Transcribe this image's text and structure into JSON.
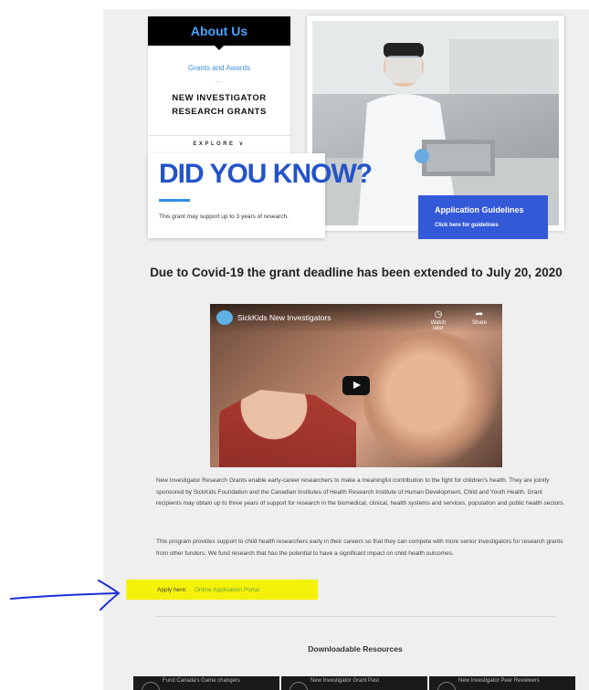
{
  "nav": {
    "header": "About Us",
    "link": "Grants and Awards",
    "dot": "—",
    "title_line1": "NEW INVESTIGATOR",
    "title_line2": "RESEARCH GRANTS",
    "explore": "EXPLORE",
    "explore_icon": "∨"
  },
  "did_you_know": {
    "title": "DID YOU KNOW?",
    "text": "This grant may support up to 3 years of research."
  },
  "guidelines": {
    "title": "Application Guidelines",
    "subtitle": "Click here for guidelines"
  },
  "headline": "Due to Covid-19 the grant deadline has been extended to July 20, 2020",
  "video": {
    "title": "SickKids New Investigators",
    "watch_later": "Watch later",
    "share": "Share"
  },
  "paragraphs": {
    "p1": "New Investigator Research Grants enable early-career researchers to make a meaningful contribution to the fight for children's health. They are jointly sponsored by SickKids Foundation and the Canadian Institutes of Health Research Institute of Human Development, Child and Youth Health. Grant recipients may obtain up to three years of support for research in the biomedical, clinical, health systems and services, population and public health sectors.",
    "p2": "This program provides support to child health researchers early in their careers so that they can compete with more senior investigators for research grants from other funders. We fund research that has the potential to have a significant impact on child health outcomes."
  },
  "apply": {
    "label": "Apply here:",
    "link": "Online Application Portal",
    "highlight_color": "#f5f20a"
  },
  "resources": {
    "heading": "Downloadable Resources",
    "items": [
      "Fund Canada's Game changers",
      "New Investigator Grant Past",
      "New Investigator Peer Reviewers"
    ]
  },
  "colors": {
    "accent_blue": "#2454c9",
    "guidelines_bg": "#3358d8",
    "link_green": "#5fa63a",
    "annotation_arrow": "#1a2fd6"
  }
}
